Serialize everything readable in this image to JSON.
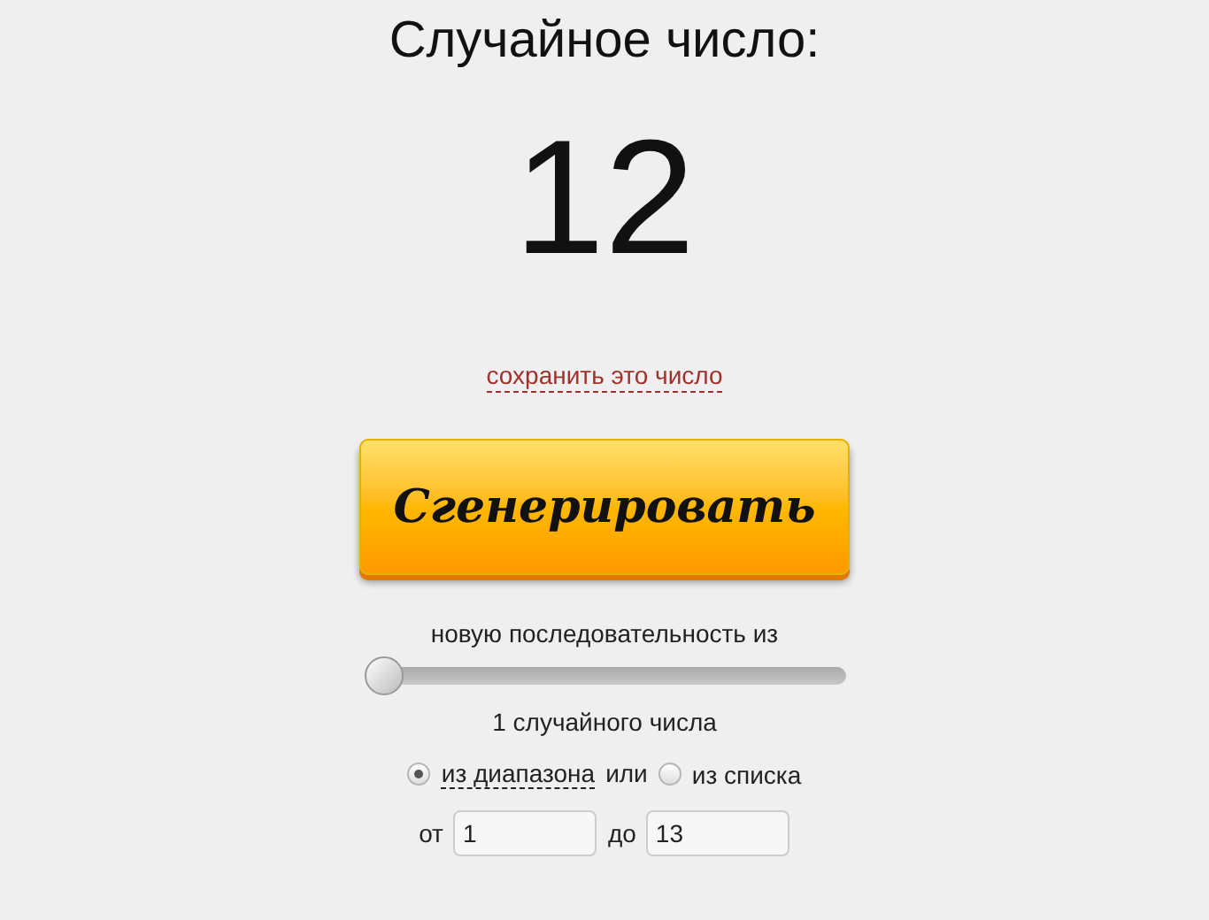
{
  "title": "Случайное число:",
  "result": "12",
  "save_link": "сохранить это число",
  "generate_button": "Сгенерировать",
  "sequence_label": "новую последовательность из",
  "count_slider": {
    "level": 0
  },
  "count_label": "1 случайного числа",
  "source_options": [
    {
      "label": "из диапазона",
      "selected": true
    },
    {
      "label": "из списка",
      "selected": false
    }
  ],
  "source_joiner": "или",
  "range": [
    {
      "label": "от",
      "value": "1"
    },
    {
      "label": "до",
      "value": "13"
    }
  ]
}
